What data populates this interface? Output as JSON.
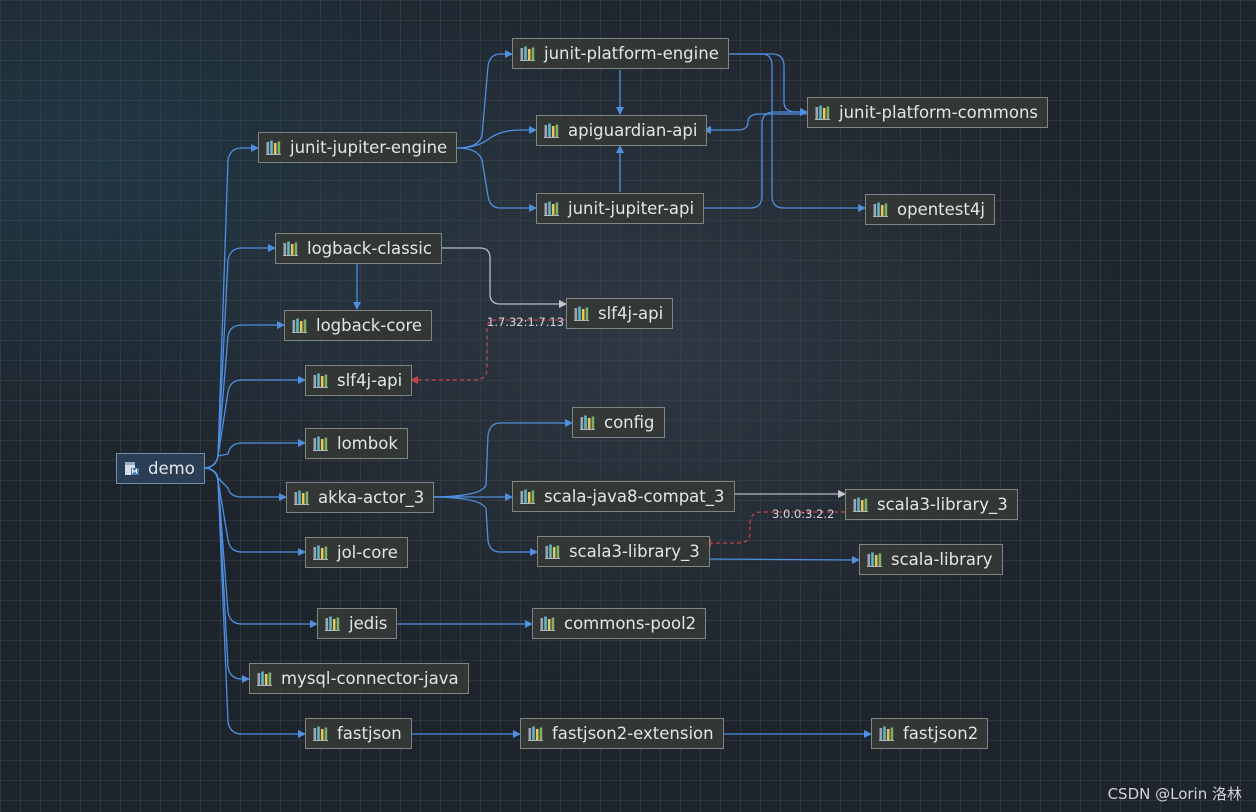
{
  "diagram": {
    "root": "demo",
    "nodes": [
      {
        "id": "junit-platform-engine",
        "label": "junit-platform-engine"
      },
      {
        "id": "junit-platform-commons",
        "label": "junit-platform-commons"
      },
      {
        "id": "apiguardian-api",
        "label": "apiguardian-api"
      },
      {
        "id": "junit-jupiter-engine",
        "label": "junit-jupiter-engine"
      },
      {
        "id": "junit-jupiter-api",
        "label": "junit-jupiter-api"
      },
      {
        "id": "opentest4j",
        "label": "opentest4j"
      },
      {
        "id": "logback-classic",
        "label": "logback-classic"
      },
      {
        "id": "slf4j-api-2",
        "label": "slf4j-api"
      },
      {
        "id": "logback-core",
        "label": "logback-core"
      },
      {
        "id": "slf4j-api",
        "label": "slf4j-api"
      },
      {
        "id": "config",
        "label": "config"
      },
      {
        "id": "lombok",
        "label": "lombok"
      },
      {
        "id": "demo",
        "label": "demo"
      },
      {
        "id": "akka-actor_3",
        "label": "akka-actor_3"
      },
      {
        "id": "scala-java8-compat_3",
        "label": "scala-java8-compat_3"
      },
      {
        "id": "scala3-library_3-2",
        "label": "scala3-library_3"
      },
      {
        "id": "scala3-library_3",
        "label": "scala3-library_3"
      },
      {
        "id": "scala-library",
        "label": "scala-library"
      },
      {
        "id": "jol-core",
        "label": "jol-core"
      },
      {
        "id": "jedis",
        "label": "jedis"
      },
      {
        "id": "commons-pool2",
        "label": "commons-pool2"
      },
      {
        "id": "mysql-connector-java",
        "label": "mysql-connector-java"
      },
      {
        "id": "fastjson",
        "label": "fastjson"
      },
      {
        "id": "fastjson2-extension",
        "label": "fastjson2-extension"
      },
      {
        "id": "fastjson2",
        "label": "fastjson2"
      }
    ],
    "conflicts": [
      {
        "label": "1.7.32:1.7.13"
      },
      {
        "label": "3.0.0:3.2.2"
      }
    ]
  },
  "watermark": "CSDN @Lorin 洛林",
  "colors": {
    "edge": "#4f8fe0",
    "edge_alt": "#b9bcc2",
    "conflict": "#c8404a",
    "library_icon": "library-icon",
    "module_icon": "module-icon"
  }
}
